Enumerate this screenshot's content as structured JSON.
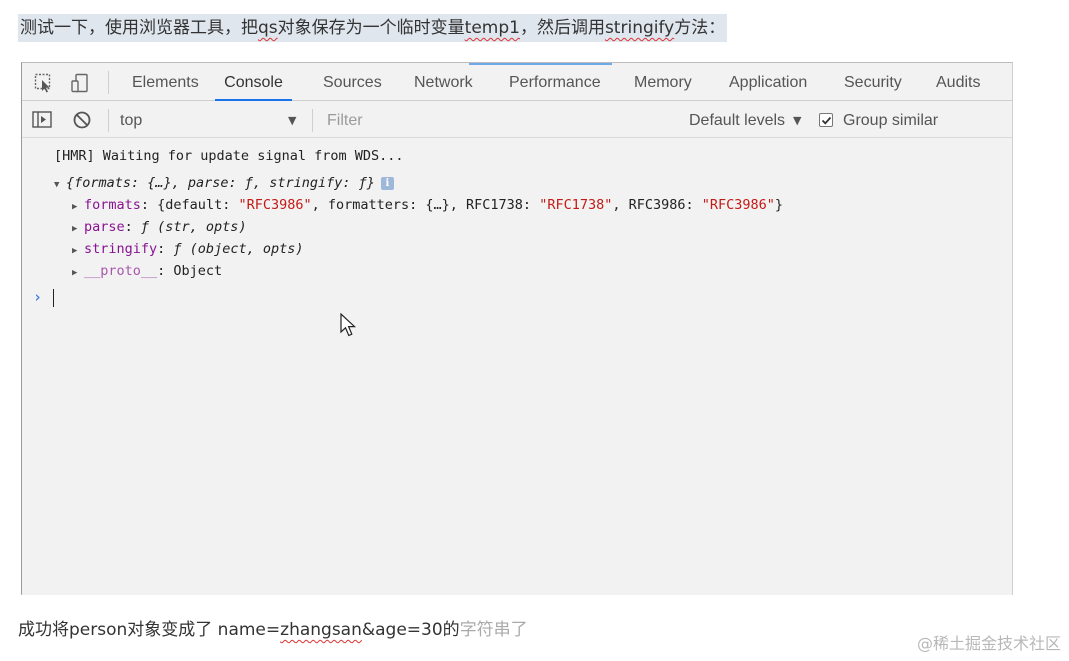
{
  "article": {
    "intro_part1": "测试一下，使用浏览器工具，把",
    "intro_qs": "qs",
    "intro_part2": "对象保存为一个临时变量",
    "intro_temp1": "temp1",
    "intro_part3": "，然后调用",
    "intro_stringify": "stringify",
    "intro_part4": "方法：",
    "result_part1": "成功将person对象变成了 name=",
    "result_zhangsan": "zhangsan",
    "result_part2": "&age=30的",
    "result_faded": "字符串了",
    "watermark": "@稀土掘金技术社区"
  },
  "devtools": {
    "tabs": [
      {
        "label": "Elements"
      },
      {
        "label": "Console",
        "active": true
      },
      {
        "label": "Sources"
      },
      {
        "label": "Network"
      },
      {
        "label": "Performance"
      },
      {
        "label": "Memory"
      },
      {
        "label": "Application"
      },
      {
        "label": "Security"
      },
      {
        "label": "Audits"
      }
    ],
    "toolbar": {
      "context": "top",
      "filter_placeholder": "Filter",
      "levels": "Default levels",
      "group_similar": "Group similar",
      "group_similar_checked": true
    },
    "icons": {
      "inspect": "inspect-element-icon",
      "device": "device-toolbar-icon",
      "sidebar": "show-sidebar-icon",
      "clear": "clear-console-icon"
    },
    "console": {
      "hmr": "[HMR] Waiting for update signal from WDS...",
      "obj_summary": "{formats: {…}, parse: ƒ, stringify: ƒ}",
      "info_badge": "i",
      "formats_key": "formats",
      "formats_pre": "{default: ",
      "formats_default": "\"RFC3986\"",
      "formats_mid1": ", formatters: {…}, RFC1738: ",
      "formats_rfc1738": "\"RFC1738\"",
      "formats_mid2": ", RFC3986: ",
      "formats_rfc3986": "\"RFC3986\"",
      "formats_end": "}",
      "parse_key": "parse",
      "parse_val": "ƒ (str, opts)",
      "stringify_key": "stringify",
      "stringify_val": "ƒ (object, opts)",
      "proto_key": "__proto__",
      "proto_val": "Object",
      "prompt": "›"
    }
  }
}
